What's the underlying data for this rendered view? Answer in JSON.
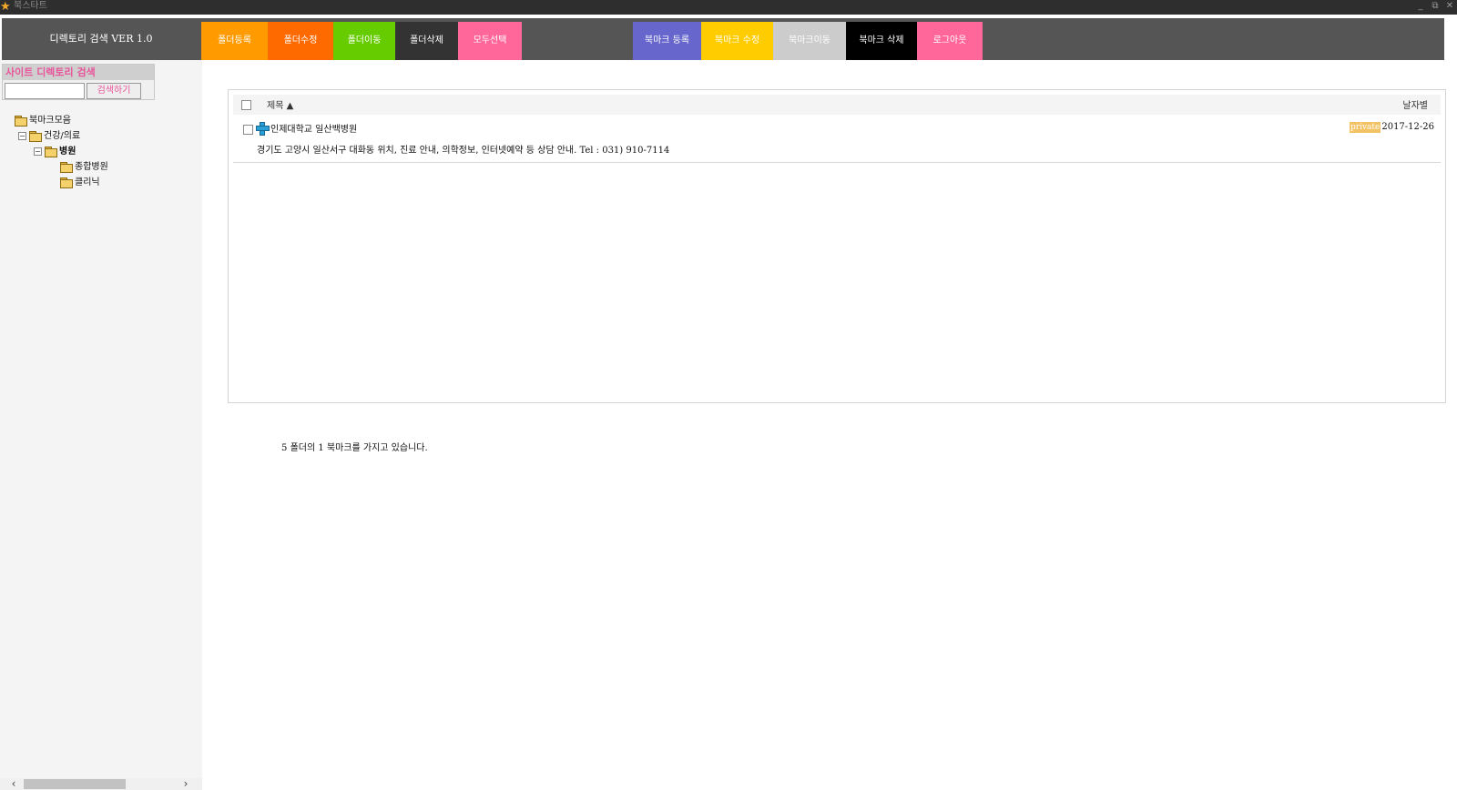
{
  "window": {
    "title": "북스타트",
    "controls": [
      "_",
      "⧉",
      "✕"
    ]
  },
  "app_title": "디렉토리 검색 VER 1.0",
  "nav_buttons": [
    {
      "label": "폴더등록",
      "color": "#ff9a00"
    },
    {
      "label": "폴더수정",
      "color": "#ff6a00"
    },
    {
      "label": "폴더이동",
      "color": "#66cc00"
    },
    {
      "label": "폴더삭제",
      "color": "#333333"
    },
    {
      "label": "모두선택",
      "color": "#ff6699"
    },
    {
      "label": "북마크 등록",
      "color": "#6666cc"
    },
    {
      "label": "북마크 수정",
      "color": "#ffcc00"
    },
    {
      "label": "북마크이동",
      "color": "#cccccc"
    },
    {
      "label": "북마크 삭제",
      "color": "#000000"
    },
    {
      "label": "로그아웃",
      "color": "#ff6699"
    }
  ],
  "sidebar": {
    "search_title": "사이트 디렉토리 검색",
    "search_value": "",
    "search_button": "검색하기",
    "tree": [
      {
        "label": "북마크모음",
        "toggle": ""
      },
      {
        "label": "건강/의료",
        "toggle": "⊟"
      },
      {
        "label": "병원",
        "toggle": "⊟"
      },
      {
        "label": "종합병원",
        "toggle": ""
      },
      {
        "label": "클리닉",
        "toggle": ""
      }
    ]
  },
  "list": {
    "col_title": "제목 ▲",
    "col_date": "날자별",
    "rows": [
      {
        "title": "인제대학교 일산백병원",
        "desc": "경기도 고양시 일산서구 대화동 위치, 진료 안내, 의학정보, 인터넷예약 등 상담 안내.",
        "tel": "Tel : 031) 910-7114",
        "badge": "private",
        "date": "2017-12-26"
      }
    ]
  },
  "summary": {
    "folders": "5",
    "text1": "폴더의",
    "bookmarks": "1",
    "text2": "북마크를 가지고 있습니다."
  }
}
